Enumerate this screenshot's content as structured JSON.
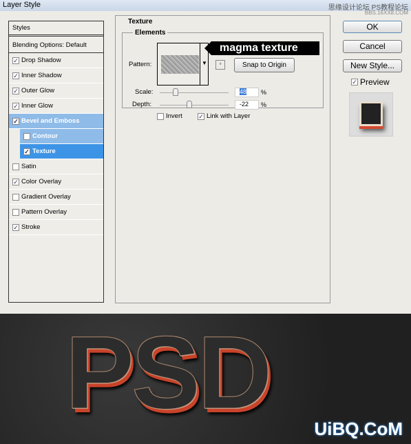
{
  "window": {
    "title": "Layer Style",
    "watermark_top": "思缘设计论坛 PS教程论坛",
    "watermark_url": "BBS.16XX8.COM"
  },
  "sidebar": {
    "header": "Styles",
    "blending": "Blending Options: Default",
    "items": [
      {
        "label": "Drop Shadow",
        "checked": true
      },
      {
        "label": "Inner Shadow",
        "checked": true
      },
      {
        "label": "Outer Glow",
        "checked": true
      },
      {
        "label": "Inner Glow",
        "checked": true
      },
      {
        "label": "Bevel and Emboss",
        "checked": true
      },
      {
        "label": "Contour",
        "checked": false
      },
      {
        "label": "Texture",
        "checked": true
      },
      {
        "label": "Satin",
        "checked": false
      },
      {
        "label": "Color Overlay",
        "checked": true
      },
      {
        "label": "Gradient Overlay",
        "checked": false
      },
      {
        "label": "Pattern Overlay",
        "checked": false
      },
      {
        "label": "Stroke",
        "checked": true
      }
    ]
  },
  "texture": {
    "group": "Texture",
    "subgroup": "Elements",
    "pattern_label": "Pattern:",
    "snap": "Snap to Origin",
    "scale_label": "Scale:",
    "scale": "48",
    "depth_label": "Depth:",
    "depth": "-22",
    "pct": "%",
    "invert": "Invert",
    "invert_checked": false,
    "link": "Link with Layer",
    "link_checked": true,
    "callout": "magma texture"
  },
  "buttons": {
    "ok": "OK",
    "cancel": "Cancel",
    "new_style": "New Style...",
    "preview": "Preview",
    "preview_checked": true
  },
  "artwork": {
    "text": "PSD",
    "watermark": "UiBQ.CoM"
  }
}
